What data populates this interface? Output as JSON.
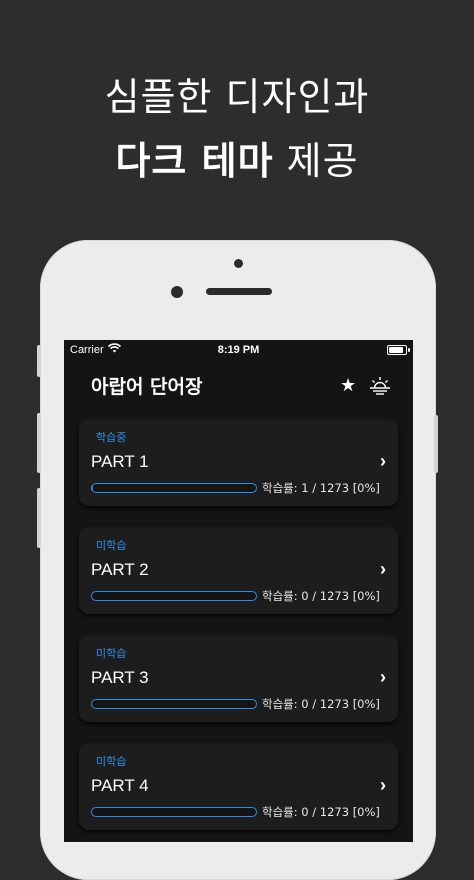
{
  "headline": {
    "line1": "심플한 디자인과",
    "line2_bold": "다크 테마",
    "line2_rest": " 제공"
  },
  "statusbar": {
    "carrier": "Carrier",
    "time": "8:19 PM"
  },
  "nav": {
    "title": "아랍어 단어장",
    "star_icon": "★",
    "theme_icon": "sunset-icon"
  },
  "parts": [
    {
      "status": "학습중",
      "title": "PART 1",
      "progress_label": "학습률: 1 / 1273 [0%]",
      "progress": 0.0008
    },
    {
      "status": "미학습",
      "title": "PART 2",
      "progress_label": "학습률: 0 / 1273 [0%]",
      "progress": 0
    },
    {
      "status": "미학습",
      "title": "PART 3",
      "progress_label": "학습률: 0 / 1273 [0%]",
      "progress": 0
    },
    {
      "status": "미학습",
      "title": "PART 4",
      "progress_label": "학습률: 0 / 1273 [0%]",
      "progress": 0
    }
  ],
  "colors": {
    "background": "#2d2d2d",
    "screen": "#141414",
    "card": "#1d1d1d",
    "accent": "#2e8ee6"
  }
}
